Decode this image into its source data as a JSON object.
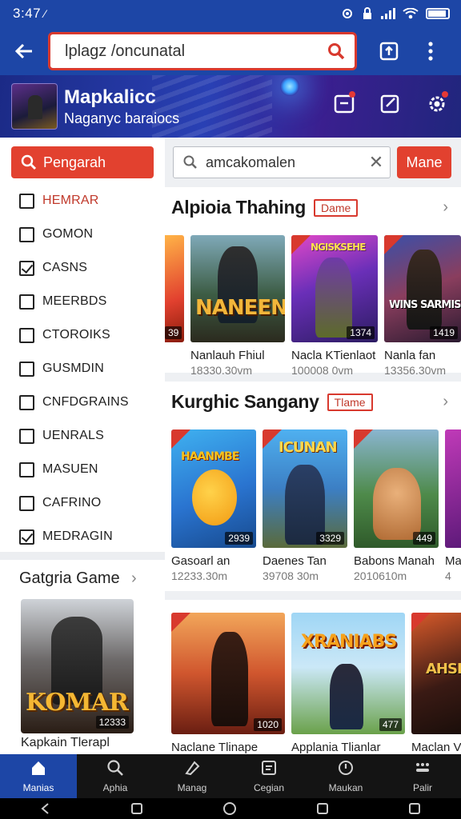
{
  "status_bar": {
    "time": "3:47",
    "time_suffix": "⁄"
  },
  "app_bar": {
    "url_text": "lplagz /oncunatal"
  },
  "hero": {
    "title": "Mapkalicc",
    "subtitle": "Naganyc baraiocs"
  },
  "sidebar": {
    "filter_label": "Pengarah",
    "items": [
      {
        "label": "HEMRAR",
        "checked": false
      },
      {
        "label": "GOMON",
        "checked": false
      },
      {
        "label": "CASNS",
        "checked": true
      },
      {
        "label": "MEERBDS",
        "checked": false
      },
      {
        "label": "CTOROIKS",
        "checked": false
      },
      {
        "label": "GUSMDIN",
        "checked": false
      },
      {
        "label": "CNFDGRAINS",
        "checked": false
      },
      {
        "label": "UENRALS",
        "checked": false
      },
      {
        "label": "MASUEN",
        "checked": false
      },
      {
        "label": "CAFRINO",
        "checked": false
      },
      {
        "label": "MEDRAGIN",
        "checked": true
      }
    ],
    "category_title": "Gatgria Game",
    "category_card": {
      "logo": "KOMAR",
      "badge": "12333",
      "name": "Kapkain Tlerapl"
    }
  },
  "main": {
    "search_placeholder": "amcakomalen",
    "search_button": "Mane",
    "sections": [
      {
        "title": "Alpioia Thahing",
        "tag": "Dame",
        "cards": [
          {
            "logo": "",
            "badge": "39",
            "name": "",
            "meta": ""
          },
          {
            "logo": "NANEEN",
            "badge": "",
            "name": "Nanlauh Fhiul",
            "meta": "18330.30vm"
          },
          {
            "logo": "NGISKSEHE",
            "badge": "1374",
            "name": "Nacla KTienlaot",
            "meta": "100008 0vm"
          },
          {
            "logo": "WINS SARMIS",
            "badge": "1419",
            "name": "Nanla fan",
            "meta": "13356.30vm"
          }
        ]
      },
      {
        "title": "Kurghic Sangany",
        "tag": "Tlame",
        "cards": [
          {
            "logo": "HAANMBE",
            "badge": "2939",
            "name": "Gasoarl an",
            "meta": "12233.30m"
          },
          {
            "logo": "ICUNAN",
            "badge": "3329",
            "name": "Daenes Tan",
            "meta": "39708 30m"
          },
          {
            "logo": "",
            "badge": "449",
            "name": "Babons Manah",
            "meta": "2010610m"
          },
          {
            "logo": "",
            "badge": "",
            "name": "Ma",
            "meta": "4"
          }
        ]
      },
      {
        "title": "",
        "tag": "",
        "cards": [
          {
            "logo": "",
            "badge": "1020",
            "name": "Naclane Tlinape",
            "meta": ""
          },
          {
            "logo": "XRANIABS",
            "badge": "477",
            "name": "Applania Tlianlar",
            "meta": ""
          },
          {
            "logo": "AHSE",
            "badge": "",
            "name": "Maclan V",
            "meta": ""
          }
        ]
      }
    ]
  },
  "bottom_nav": [
    "Manias",
    "Aphia",
    "Manag",
    "Cegian",
    "Maukan",
    "Palir"
  ],
  "colors": {
    "primary": "#1d46a6",
    "accent": "#e2412f"
  }
}
